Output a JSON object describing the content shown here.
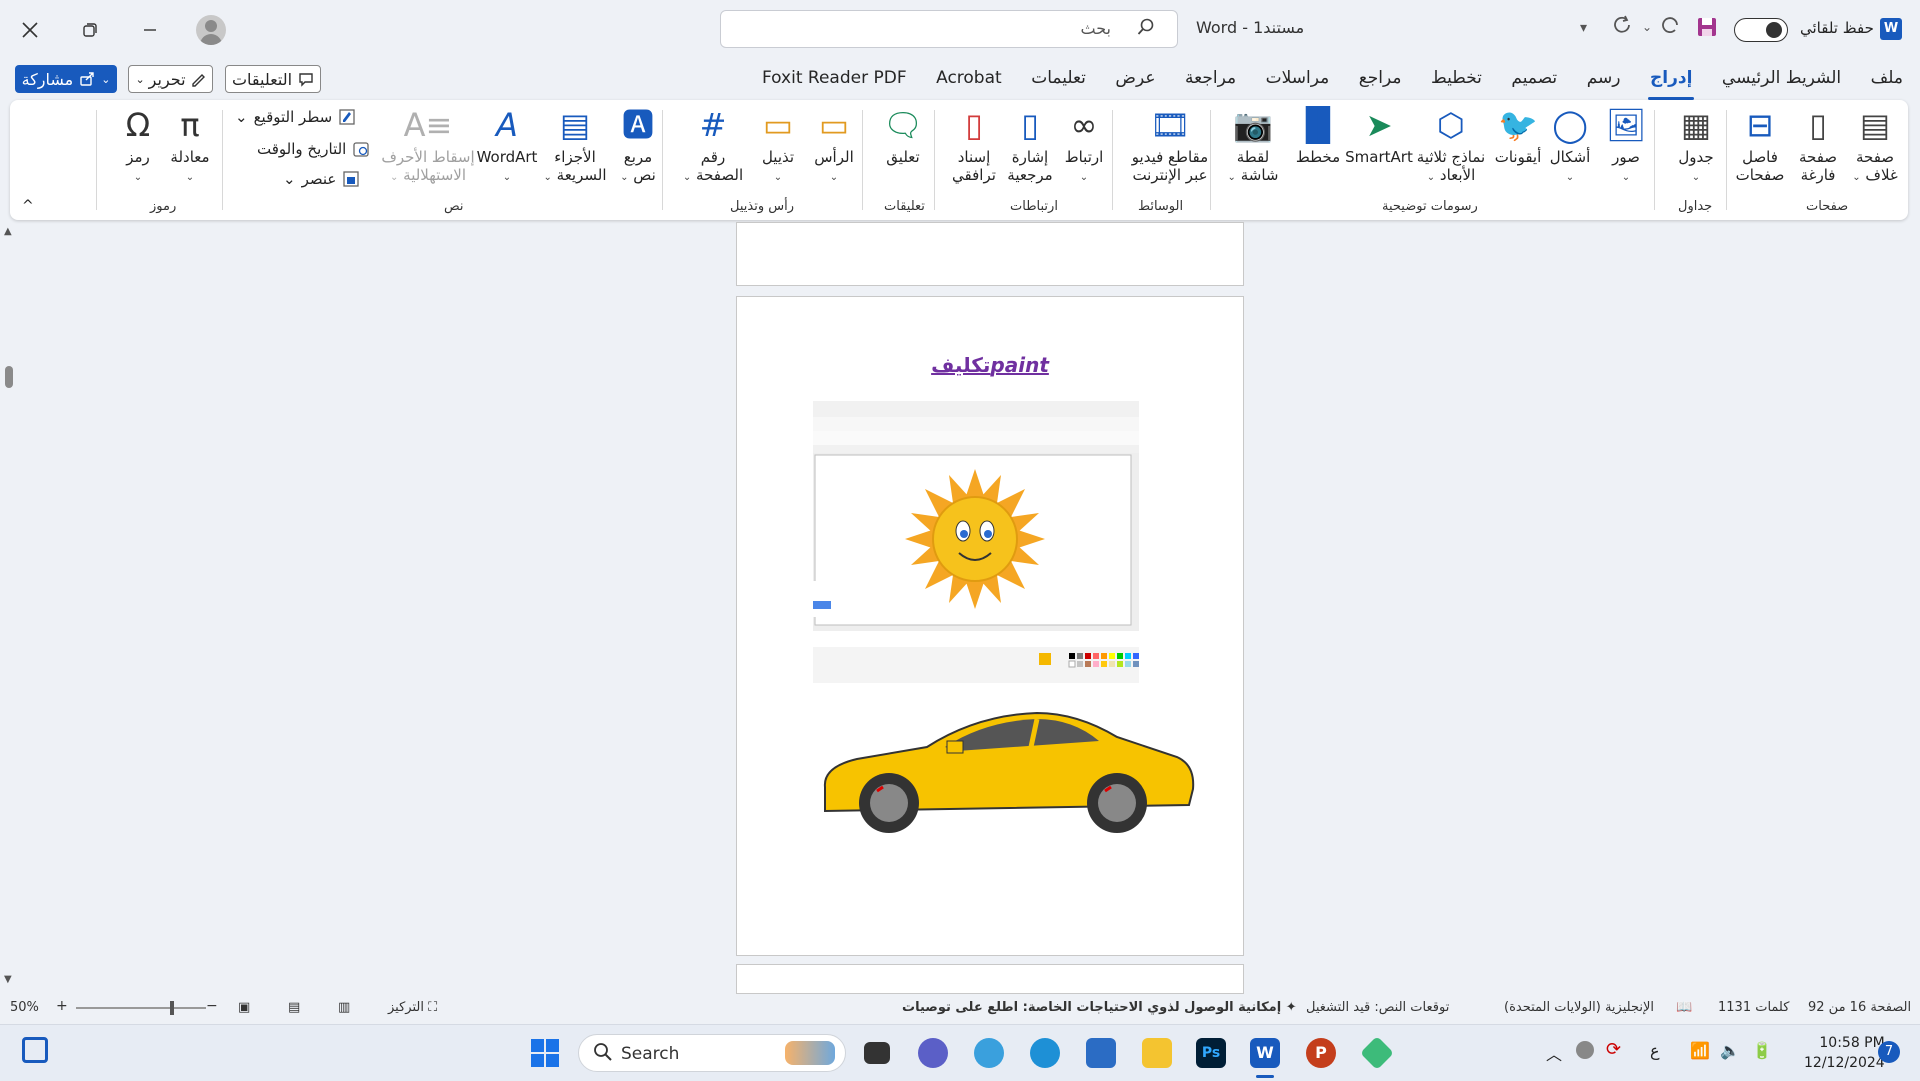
{
  "window": {
    "app_name": "Word",
    "doc_name": "مستند1",
    "separator": "-",
    "autosave_label": "حفظ تلقائي",
    "search_placeholder": "بحث"
  },
  "header_buttons": {
    "share_label": "مشاركة",
    "edit_label": "تحرير",
    "comments_label": "التعليقات"
  },
  "tabs": [
    {
      "label": "ملف",
      "active": false
    },
    {
      "label": "الشريط الرئيسي",
      "active": false
    },
    {
      "label": "إدراج",
      "active": true
    },
    {
      "label": "رسم",
      "active": false
    },
    {
      "label": "تصميم",
      "active": false
    },
    {
      "label": "تخطيط",
      "active": false
    },
    {
      "label": "مراجع",
      "active": false
    },
    {
      "label": "مراسلات",
      "active": false
    },
    {
      "label": "مراجعة",
      "active": false
    },
    {
      "label": "عرض",
      "active": false
    },
    {
      "label": "تعليمات",
      "active": false
    },
    {
      "label": "Acrobat",
      "active": false
    },
    {
      "label": "Foxit Reader PDF",
      "active": false
    }
  ],
  "ribbon": {
    "pages": {
      "group": "صفحات",
      "cover_l1": "صفحة",
      "cover_l2": "غلاف",
      "blank_l1": "صفحة",
      "blank_l2": "فارغة",
      "break_l1": "فاصل",
      "break_l2": "صفحات"
    },
    "tables": {
      "group": "جداول",
      "table": "جدول"
    },
    "illustrations": {
      "group": "رسومات توضيحية",
      "pictures": "صور",
      "shapes": "أشكال",
      "icons": "أيقونات",
      "models_l1": "نماذج ثلاثية",
      "models_l2": "الأبعاد",
      "smartart": "SmartArt",
      "chart": "مخطط",
      "screenshot_l1": "لقطة",
      "screenshot_l2": "شاشة"
    },
    "media": {
      "group": "الوسائط",
      "video_l1": "مقاطع فيديو",
      "video_l2": "عبر الإنترنت"
    },
    "links": {
      "group": "ارتباطات",
      "link": "ارتباط",
      "bookmark_l1": "إشارة",
      "bookmark_l2": "مرجعية",
      "cross_l1": "إسناد",
      "cross_l2": "ترافقي"
    },
    "comments": {
      "group": "تعليقات",
      "comment": "تعليق"
    },
    "header_footer": {
      "group": "رأس وتذييل",
      "header": "الرأس",
      "footer": "تذييل",
      "page_l1": "رقم",
      "page_l2": "الصفحة"
    },
    "text": {
      "group": "نص",
      "textbox_l1": "مربع",
      "textbox_l2": "نص",
      "quickparts_l1": "الأجزاء",
      "quickparts_l2": "السريعة",
      "wordart": "WordArt",
      "dropcap_l1": "إسقاط الأحرف",
      "dropcap_l2": "الاستهلالية",
      "signature": "سطر التوقيع",
      "datetime": "التاريخ والوقت",
      "object": "عنصر"
    },
    "symbols": {
      "group": "رموز",
      "equation": "معادلة",
      "symbol": "رمز"
    }
  },
  "document": {
    "heading_ar": "تكليف",
    "heading_latin": "paint"
  },
  "status": {
    "page": "الصفحة 16 من 92",
    "words": "1131 كلمات",
    "language": "الإنجليزية (الولايات المتحدة)",
    "predictions": "توقعات النص: قيد التشغيل",
    "accessibility": "إمكانية الوصول لذوي الاحتياجات الخاصة: اطلع على توصيات",
    "focus": "التركيز",
    "zoom": "50%"
  },
  "taskbar": {
    "search_label": "Search",
    "time": "10:58 PM",
    "date": "12/12/2024",
    "notification_count": "7",
    "ime": "ع"
  },
  "colors": {
    "accent": "#185abd",
    "heading": "#7030a0",
    "sun": "#f6c21c",
    "car": "#f7c300"
  }
}
